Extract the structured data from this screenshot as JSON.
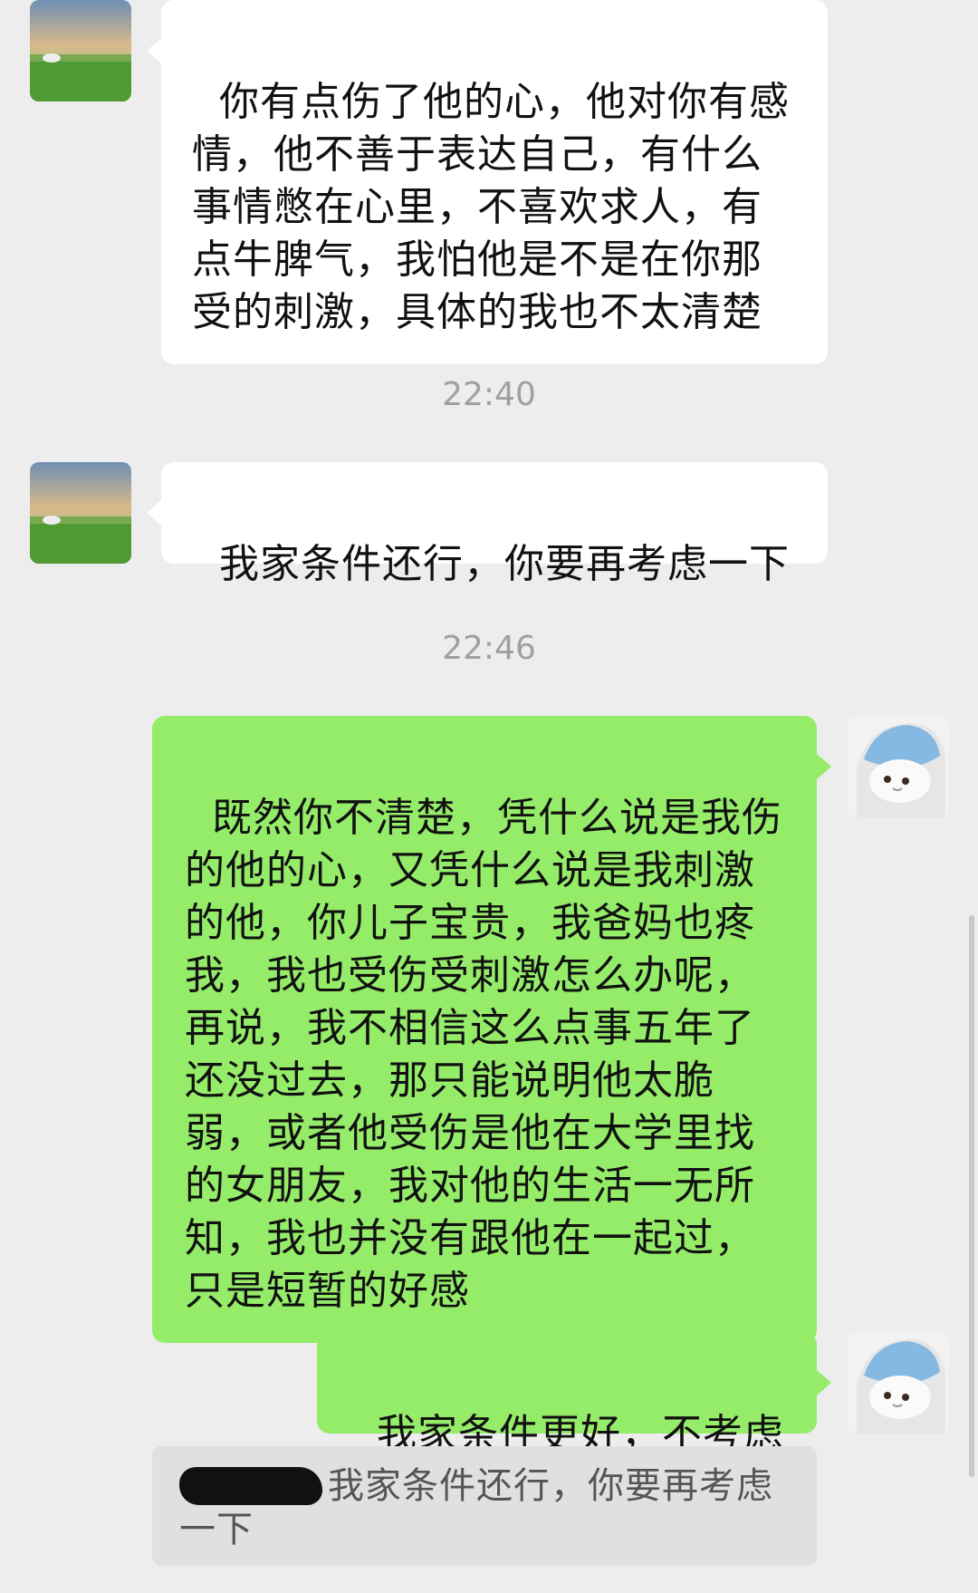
{
  "colors": {
    "background": "#ededed",
    "incoming_bubble": "#ffffff",
    "outgoing_bubble": "#95ec69",
    "timestamp_text": "#a0a0a0",
    "quote_background": "#e0e0e0"
  },
  "icons": {
    "contact_avatar": "grassland-avatar-icon",
    "self_avatar": "plush-toy-avatar-icon"
  },
  "messages": {
    "m1": "你有点伤了他的心，他对你有感情，他不善于表达自己，有什么事情憋在心里，不喜欢求人，有点牛脾气，我怕他是不是在你那受的刺激，具体的我也不太清楚",
    "m2": "我家条件还行，你要再考虑一下",
    "m3": "既然你不清楚，凭什么说是我伤的他的心，又凭什么说是我刺激的他，你儿子宝贵，我爸妈也疼我，我也受伤受刺激怎么办呢，再说，我不相信这么点事五年了还没过去，那只能说明他太脆弱，或者他受伤是他在大学里找的女朋友，我对他的生活一无所知，我也并没有跟他在一起过，只是短暂的好感",
    "m4": "我家条件更好，不考虑"
  },
  "timestamps": {
    "t1": "22:40",
    "t2": "22:46"
  },
  "quote": {
    "text": "我家条件还行，你要再考虑一下"
  }
}
